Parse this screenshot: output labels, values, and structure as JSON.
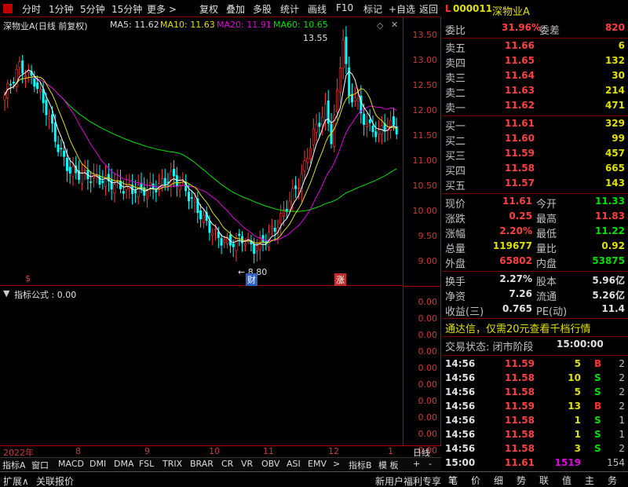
{
  "toolbar": {
    "items": [
      "分时",
      "1分钟",
      "5分钟",
      "15分钟",
      "更多 >",
      "复权",
      "叠加",
      "多股",
      "统计",
      "画线",
      "F10",
      "标记",
      "+自选",
      "返回"
    ]
  },
  "chart": {
    "title": "深物业A(日线 前复权)",
    "ma5": "MA5: 11.62",
    "ma10": "MA10: 11.63",
    "ma20": "MA20: 11.91",
    "ma60": "MA60: 10.65",
    "high_label": "13.55",
    "low_label": "8.80",
    "marker_s": "$",
    "marker_cai": "财",
    "marker_zhang": "涨",
    "price_ticks": [
      "13.50",
      "13.00",
      "12.50",
      "12.00",
      "11.50",
      "11.00",
      "10.50",
      "10.00",
      "9.50",
      "9.00"
    ],
    "colors": {
      "ma5": "#ffffff",
      "ma10": "#e0e000",
      "ma20": "#e000e0",
      "ma60": "#00e000",
      "up": "#ff3c3c",
      "down": "#00ffff"
    }
  },
  "indicator": {
    "title": "指标公式 : 0.00",
    "ticks": [
      "0.00",
      "0.00",
      "0.00",
      "0.00",
      "0.00",
      "0.00",
      "0.00",
      "0.00",
      "0.00",
      "0.00"
    ]
  },
  "date_axis": {
    "labels": [
      "2022年",
      "8",
      "9",
      "10",
      "11",
      "12",
      "1"
    ],
    "period": "日线"
  },
  "ind_tabs": [
    "指标A",
    "窗口",
    "MACD",
    "DMI",
    "DMA",
    "FSL",
    "TRIX",
    "BRAR",
    "CR",
    "VR",
    "OBV",
    "ASI",
    "EMV",
    ">",
    "指标B",
    "模 板",
    "+",
    "-"
  ],
  "status": {
    "left1": "扩展∧",
    "left2": "关联报价",
    "right": "新用户福利专享"
  },
  "quote": {
    "code": "000011",
    "name": "深物业A",
    "weibi_label": "委比",
    "weibi": "31.96%",
    "weicha_label": "委差",
    "weicha": "820",
    "asks": [
      {
        "label": "卖五",
        "price": "11.66",
        "vol": "6"
      },
      {
        "label": "卖四",
        "price": "11.65",
        "vol": "132"
      },
      {
        "label": "卖三",
        "price": "11.64",
        "vol": "30"
      },
      {
        "label": "卖二",
        "price": "11.63",
        "vol": "214"
      },
      {
        "label": "卖一",
        "price": "11.62",
        "vol": "471"
      }
    ],
    "bids": [
      {
        "label": "买一",
        "price": "11.61",
        "vol": "329"
      },
      {
        "label": "买二",
        "price": "11.60",
        "vol": "99"
      },
      {
        "label": "买三",
        "price": "11.59",
        "vol": "457"
      },
      {
        "label": "买四",
        "price": "11.58",
        "vol": "665"
      },
      {
        "label": "买五",
        "price": "11.57",
        "vol": "143"
      }
    ],
    "stats": [
      {
        "l1": "现价",
        "v1": "11.61",
        "l2": "今开",
        "v2": "11.33"
      },
      {
        "l1": "涨跌",
        "v1": "0.25",
        "l2": "最高",
        "v2": "11.83"
      },
      {
        "l1": "涨幅",
        "v1": "2.20%",
        "l2": "最低",
        "v2": "11.22"
      },
      {
        "l1": "总量",
        "v1": "119677",
        "l2": "量比",
        "v2": "0.92"
      },
      {
        "l1": "外盘",
        "v1": "65802",
        "l2": "内盘",
        "v2": "53875"
      }
    ],
    "stats2": [
      {
        "l1": "换手",
        "v1": "2.27%",
        "l2": "股本",
        "v2": "5.96亿"
      },
      {
        "l1": "净资",
        "v1": "7.26",
        "l2": "流通",
        "v2": "5.26亿"
      },
      {
        "l1": "收益(三)",
        "v1": "0.765",
        "l2": "PE(动)",
        "v2": "11.4"
      }
    ],
    "promo": "通达信，仅需20元查看千档行情",
    "trade_state": "交易状态: 闭市阶段",
    "trade_time": "15:00:00",
    "ticks": [
      {
        "t": "14:56",
        "p": "11.59",
        "v": "5",
        "bs": "B",
        "n": "2"
      },
      {
        "t": "14:56",
        "p": "11.58",
        "v": "10",
        "bs": "S",
        "n": "2"
      },
      {
        "t": "14:56",
        "p": "11.58",
        "v": "5",
        "bs": "S",
        "n": "2"
      },
      {
        "t": "14:56",
        "p": "11.59",
        "v": "13",
        "bs": "B",
        "n": "2"
      },
      {
        "t": "14:56",
        "p": "11.58",
        "v": "1",
        "bs": "S",
        "n": "1"
      },
      {
        "t": "14:56",
        "p": "11.58",
        "v": "1",
        "bs": "S",
        "n": "1"
      },
      {
        "t": "14:56",
        "p": "11.58",
        "v": "3",
        "bs": "S",
        "n": "2"
      },
      {
        "t": "15:00",
        "p": "11.61",
        "v": "1519",
        "bs": "",
        "n": "154"
      }
    ],
    "bottom_tabs": [
      "笔",
      "价",
      "细",
      "势",
      "联",
      "值",
      "主",
      "务"
    ]
  }
}
